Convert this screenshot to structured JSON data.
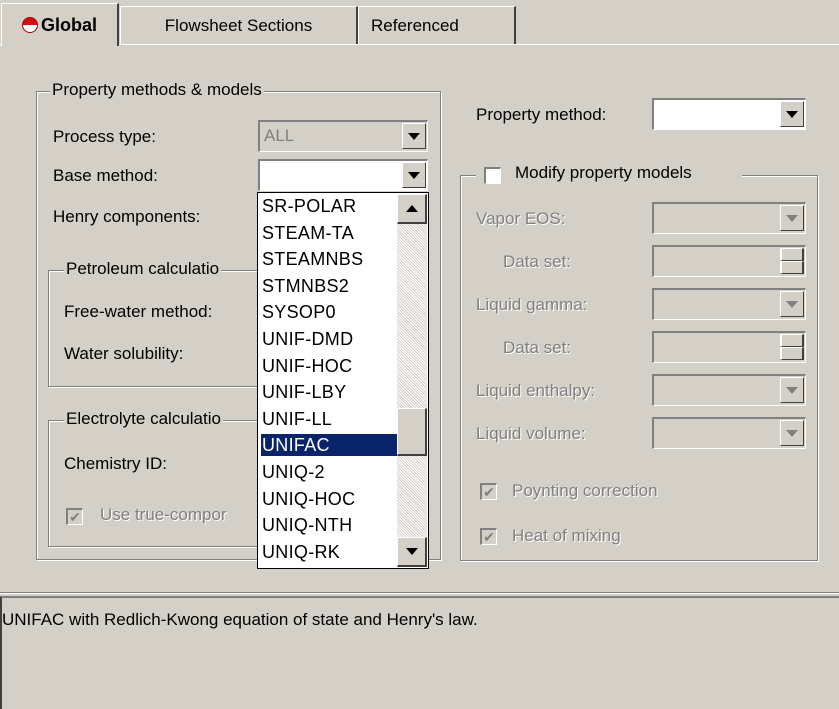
{
  "tabs": [
    {
      "label": "Global",
      "active": true,
      "status_icon": "red-half-circle-icon"
    },
    {
      "label": "Flowsheet Sections",
      "active": false
    },
    {
      "label": "Referenced",
      "active": false
    }
  ],
  "left_panel": {
    "property_methods": {
      "legend": "Property methods & models",
      "process_type_label": "Process type:",
      "process_type_value": "ALL",
      "base_method_label": "Base method:",
      "base_method_value": "",
      "henry_label": "Henry components:"
    },
    "petroleum": {
      "legend": "Petroleum calculatio",
      "free_water_label": "Free-water method:",
      "water_solubility_label": "Water solubility:"
    },
    "electrolyte": {
      "legend": "Electrolyte calculatio",
      "chemistry_label": "Chemistry ID:",
      "use_true_label": "Use true-compor",
      "use_true_checked": true
    }
  },
  "dropdown": {
    "items": [
      "SR-POLAR",
      "STEAM-TA",
      "STEAMNBS",
      "STMNBS2",
      "SYSOP0",
      "UNIF-DMD",
      "UNIF-HOC",
      "UNIF-LBY",
      "UNIF-LL",
      "UNIFAC",
      "UNIQ-2",
      "UNIQ-HOC",
      "UNIQ-NTH",
      "UNIQ-RK"
    ],
    "selected": "UNIFAC"
  },
  "right_panel": {
    "property_method_label": "Property method:",
    "property_method_value": "",
    "modify_label": "Modify property models",
    "modify_checked": false,
    "vapor_eos_label": "Vapor EOS:",
    "data_set_label_1": "Data set:",
    "liquid_gamma_label": "Liquid gamma:",
    "data_set_label_2": "Data set:",
    "liquid_enthalpy_label": "Liquid enthalpy:",
    "liquid_volume_label": "Liquid volume:",
    "poynting_label": "Poynting correction",
    "poynting_checked": true,
    "heat_mixing_label": "Heat of mixing",
    "heat_mixing_checked": true
  },
  "status_text": "UNIFAC with Redlich-Kwong equation of state and Henry's law.",
  "colors": {
    "selection": "#0a246a",
    "face": "#d4d0c8",
    "icon_red": "#d01010"
  }
}
